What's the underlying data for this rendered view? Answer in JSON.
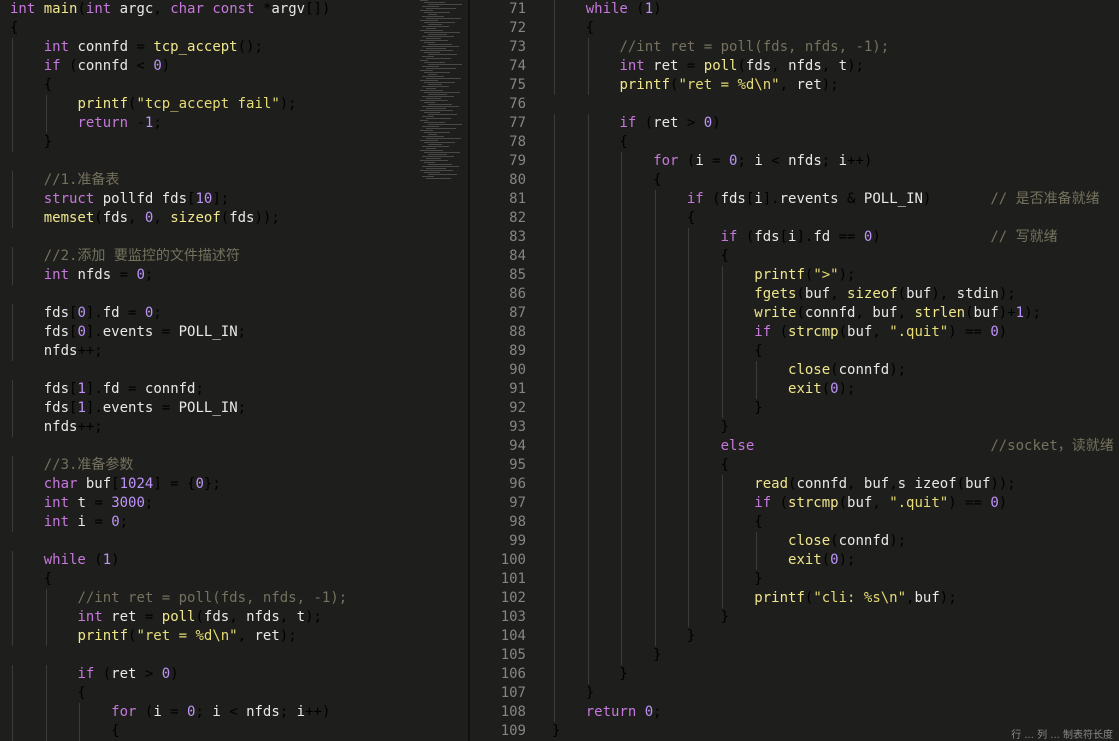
{
  "left_lines": [
    "int main(int argc, char const *argv[])",
    "{",
    "    int connfd = tcp_accept();",
    "    if (connfd < 0)",
    "    {",
    "        printf(\"tcp_accept fail\");",
    "        return -1;",
    "    }",
    "",
    "    //1.准备表",
    "    struct pollfd fds[10];",
    "    memset(fds, 0, sizeof(fds));",
    "",
    "    //2.添加 要监控的文件描述符",
    "    int nfds = 0;",
    "",
    "    fds[0].fd = 0;",
    "    fds[0].events = POLL_IN;",
    "    nfds++;",
    "",
    "    fds[1].fd = connfd;",
    "    fds[1].events = POLL_IN;",
    "    nfds++;",
    "",
    "    //3.准备参数",
    "    char buf[1024] = {0};",
    "    int t = 3000;",
    "    int i = 0;",
    "",
    "    while (1)",
    "    {",
    "        //int ret = poll(fds, nfds, -1);",
    "        int ret = poll(fds, nfds, t);",
    "        printf(\"ret = %d\\n\", ret);",
    "",
    "        if (ret > 0)",
    "        {",
    "            for (i = 0; i < nfds; i++)",
    "            {"
  ],
  "right_line_numbers": [
    "71",
    "72",
    "73",
    "74",
    "75",
    "76",
    "77",
    "78",
    "79",
    "80",
    "81",
    "82",
    "83",
    "84",
    "85",
    "86",
    "87",
    "88",
    "89",
    "90",
    "91",
    "92",
    "93",
    "94",
    "95",
    "96",
    "97",
    "98",
    "99",
    "100",
    "101",
    "102",
    "103",
    "104",
    "105",
    "106",
    "107",
    "108",
    "109"
  ],
  "right_lines": [
    "    while (1)",
    "    {",
    "        //int ret = poll(fds, nfds, -1);",
    "        int ret = poll(fds, nfds, t);",
    "        printf(\"ret = %d\\n\", ret);",
    "",
    "        if (ret > 0)",
    "        {",
    "            for (i = 0; i < nfds; i++)",
    "            {",
    "                if (fds[i].revents & POLL_IN)       // 是否准备就绪",
    "                {",
    "                    if (fds[i].fd == 0)             // 写就绪",
    "                    {",
    "                        printf(\">\");",
    "                        fgets(buf, sizeof(buf), stdin);",
    "                        write(connfd, buf, strlen(buf)+1);",
    "                        if (strcmp(buf, \".quit\") == 0)",
    "                        {",
    "                            close(connfd);",
    "                            exit(0);",
    "                        }",
    "                    }",
    "                    else                            //socket，读就绪",
    "                    {",
    "                        read(connfd, buf,s izeof(buf));",
    "                        if (strcmp(buf, \".quit\") == 0)",
    "                        {",
    "                            close(connfd);",
    "                            exit(0);",
    "                        }",
    "                        printf(\"cli: %s\\n\",buf);",
    "                    }",
    "                }",
    "            }",
    "        }",
    "    }",
    "    return 0;",
    "}"
  ],
  "status_text": "行 ... 列 ...  制表符长度"
}
